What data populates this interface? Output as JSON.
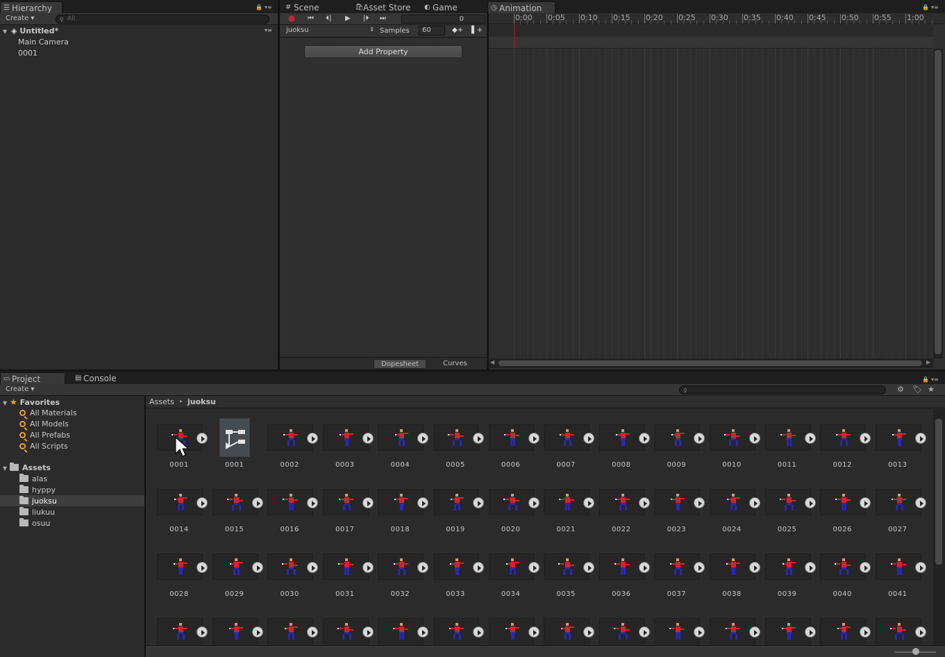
{
  "hierarchy": {
    "tab": "Hierarchy",
    "create": "Create",
    "search_placeholder": "All",
    "scene": "Untitled*",
    "items": [
      "Main Camera",
      "0001"
    ]
  },
  "center_tabs": [
    "Scene",
    "Asset Store",
    "Game"
  ],
  "animation": {
    "tab": "Animation",
    "frame": "0",
    "clip": "juoksu",
    "samples_label": "Samples",
    "samples_value": "60",
    "add_property": "Add Property",
    "dopesheet": "Dopesheet",
    "curves": "Curves",
    "ruler": [
      "0:00",
      "0:05",
      "0:10",
      "0:15",
      "0:20",
      "0:25",
      "0:30",
      "0:35",
      "0:40",
      "0:45",
      "0:50",
      "0:55",
      "1:00"
    ]
  },
  "bottom_tabs": [
    "Project",
    "Console"
  ],
  "project": {
    "create": "Create",
    "favorites_title": "Favorites",
    "favorites": [
      "All Materials",
      "All Models",
      "All Prefabs",
      "All Scripts"
    ],
    "assets_title": "Assets",
    "folders": [
      "alas",
      "hyppy",
      "juoksu",
      "liukuu",
      "osuu"
    ],
    "selected_folder": "juoksu",
    "breadcrumb": [
      "Assets",
      "juoksu"
    ],
    "assets": [
      "0001",
      "0001",
      "0002",
      "0003",
      "0004",
      "0005",
      "0006",
      "0007",
      "0008",
      "0009",
      "0010",
      "0011",
      "0012",
      "0013",
      "0014",
      "0015",
      "0016",
      "0017",
      "0018",
      "0019",
      "0020",
      "0021",
      "0022",
      "0023",
      "0024",
      "0025",
      "0026",
      "0027",
      "0028",
      "0029",
      "0030",
      "0031",
      "0032",
      "0033",
      "0034",
      "0035",
      "0036",
      "0037",
      "0038",
      "0039",
      "0040",
      "0041"
    ],
    "last_row_count": 14
  },
  "colors": {
    "record": "#c2272d",
    "playhead": "#b21d1d",
    "favorites_icon": "#e7a227",
    "sprite_shirt": "#d3242a",
    "sprite_pants": "#2828b8"
  }
}
